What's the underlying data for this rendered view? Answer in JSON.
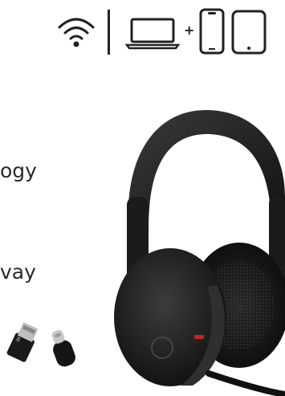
{
  "connectivity": {
    "icons": [
      "wireless-signal-icon",
      "laptop-icon",
      "smartphone-icon",
      "tablet-icon"
    ],
    "plus_sign": "+"
  },
  "feature_text": {
    "line1": "ogy",
    "line2": "vay"
  },
  "product": {
    "headset": "headset-image",
    "adapters": [
      "usb-a-adapter-image",
      "usb-c-adapter-image"
    ],
    "accent_color": "#d0202a"
  }
}
